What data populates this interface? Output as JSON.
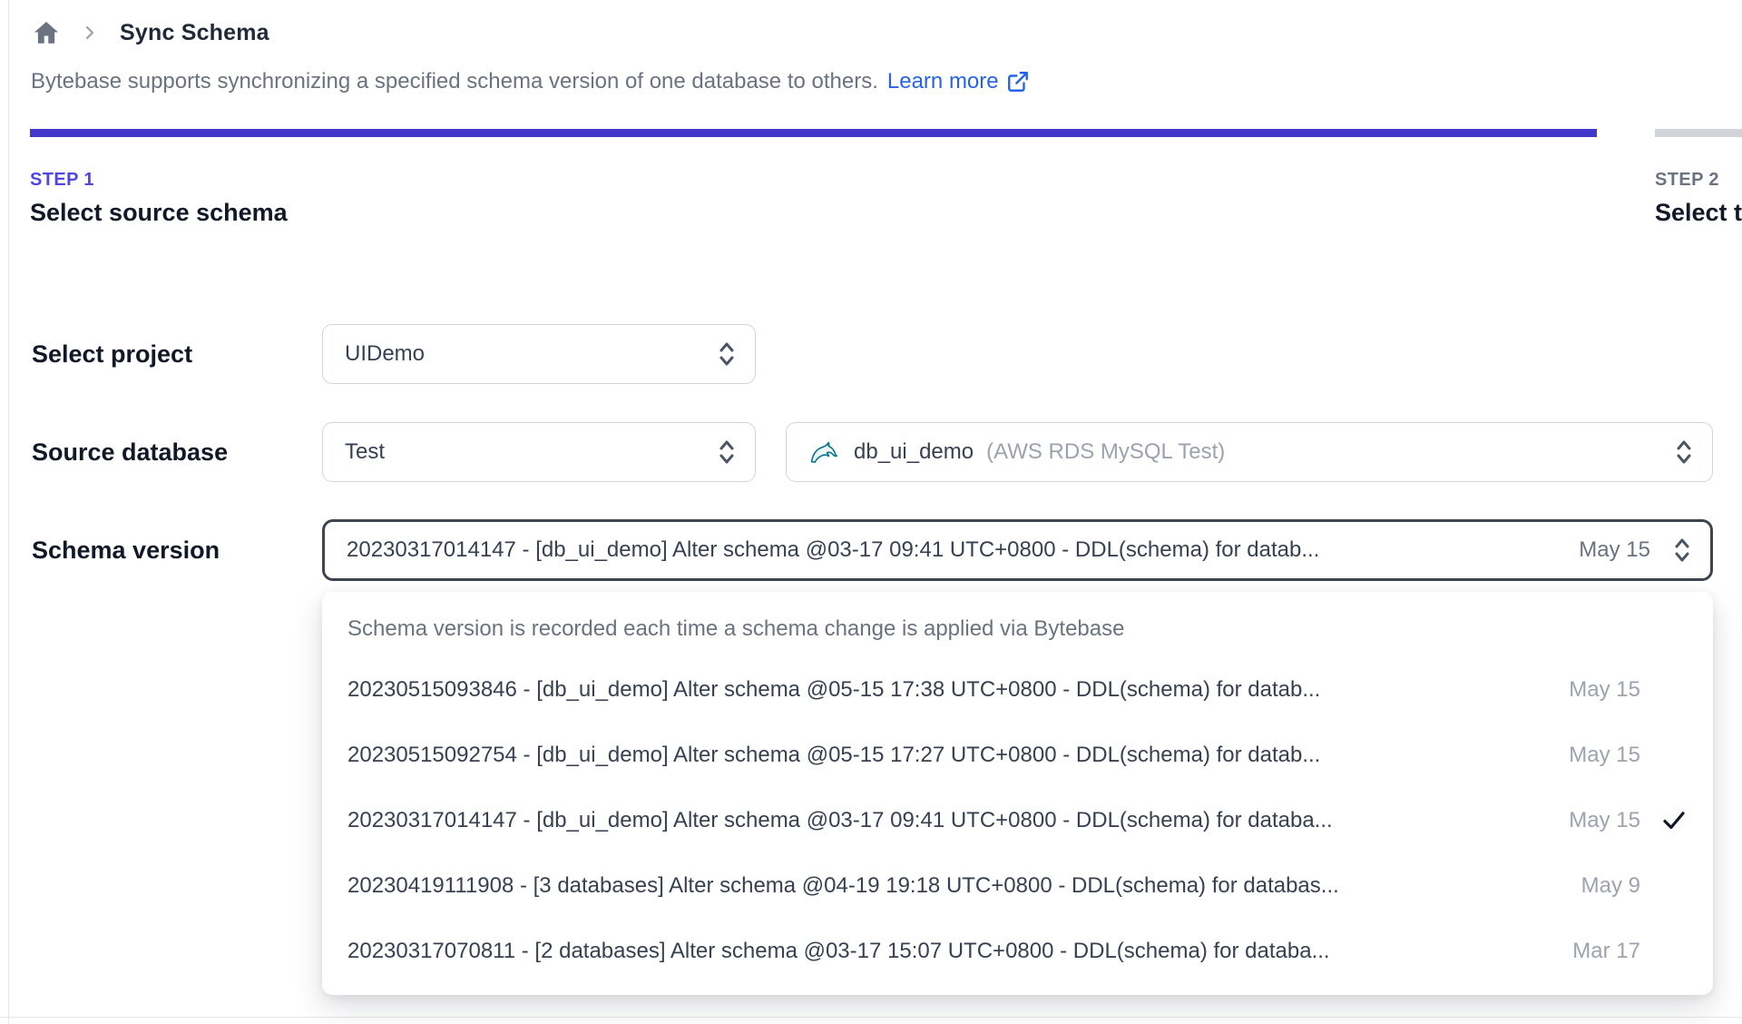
{
  "breadcrumb": {
    "title": "Sync Schema"
  },
  "intro": {
    "text": "Bytebase supports synchronizing a specified schema version of one database to others.",
    "link_label": "Learn more"
  },
  "steps": [
    {
      "label": "STEP 1",
      "title": "Select source schema",
      "active": true
    },
    {
      "label": "STEP 2",
      "title": "Select t",
      "active": false
    }
  ],
  "form": {
    "project": {
      "label": "Select project",
      "value": "UIDemo"
    },
    "source_database": {
      "label": "Source database",
      "environment_value": "Test",
      "database_value": "db_ui_demo",
      "database_annotation": "(AWS RDS MySQL Test)",
      "database_icon": "mysql-dolphin-icon"
    },
    "schema_version": {
      "label": "Schema version",
      "value": "20230317014147 - [db_ui_demo] Alter schema @03-17 09:41 UTC+0800 - DDL(schema) for datab...",
      "date": "May 15"
    }
  },
  "dropdown": {
    "hint": "Schema version is recorded each time a schema change is applied via Bytebase",
    "options": [
      {
        "text": "20230515093846 - [db_ui_demo] Alter schema @05-15 17:38 UTC+0800 - DDL(schema) for datab...",
        "date": "May 15",
        "selected": false
      },
      {
        "text": "20230515092754 - [db_ui_demo] Alter schema @05-15 17:27 UTC+0800 - DDL(schema) for datab...",
        "date": "May 15",
        "selected": false
      },
      {
        "text": "20230317014147 - [db_ui_demo] Alter schema @03-17 09:41 UTC+0800 - DDL(schema) for databa...",
        "date": "May 15",
        "selected": true
      },
      {
        "text": "20230419111908 - [3 databases] Alter schema @04-19 19:18 UTC+0800 - DDL(schema) for databas...",
        "date": "May 9",
        "selected": false
      },
      {
        "text": "20230317070811 - [2 databases] Alter schema @03-17 15:07 UTC+0800 - DDL(schema) for databa...",
        "date": "Mar 17",
        "selected": false
      }
    ]
  },
  "colors": {
    "accent_indigo": "#4338ca",
    "step_active": "#4f46e5",
    "link_blue": "#2563eb",
    "inactive_gray": "#d1d5db",
    "mysql_teal": "#00758f"
  }
}
